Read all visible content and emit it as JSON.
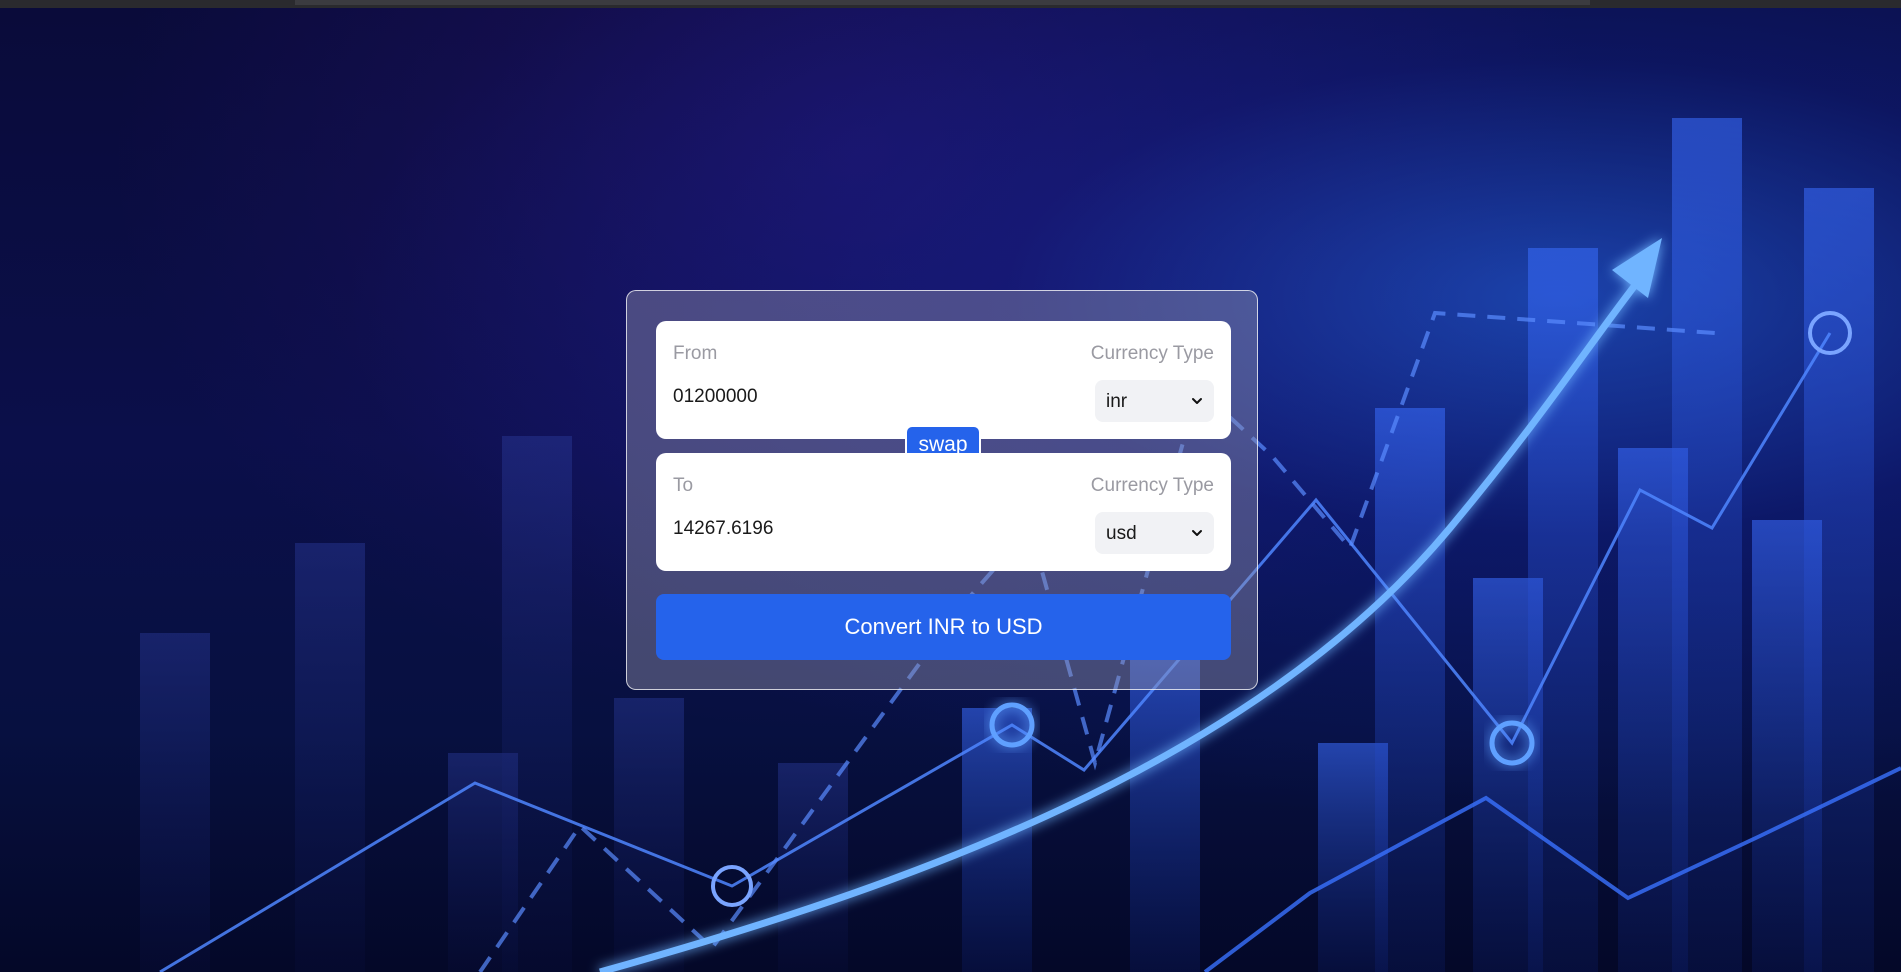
{
  "converter": {
    "from": {
      "label": "From",
      "currency_label": "Currency Type",
      "amount": "01200000",
      "currency": "inr"
    },
    "to": {
      "label": "To",
      "currency_label": "Currency Type",
      "amount": "14267.6196",
      "currency": "usd"
    },
    "swap_label": "swap",
    "convert_label": "Convert INR to USD"
  },
  "colors": {
    "accent": "#2563eb",
    "card_overlay": "#9696af",
    "background": "#0b0f4a"
  },
  "icons": {
    "select_arrow": "chevron-down-icon"
  }
}
